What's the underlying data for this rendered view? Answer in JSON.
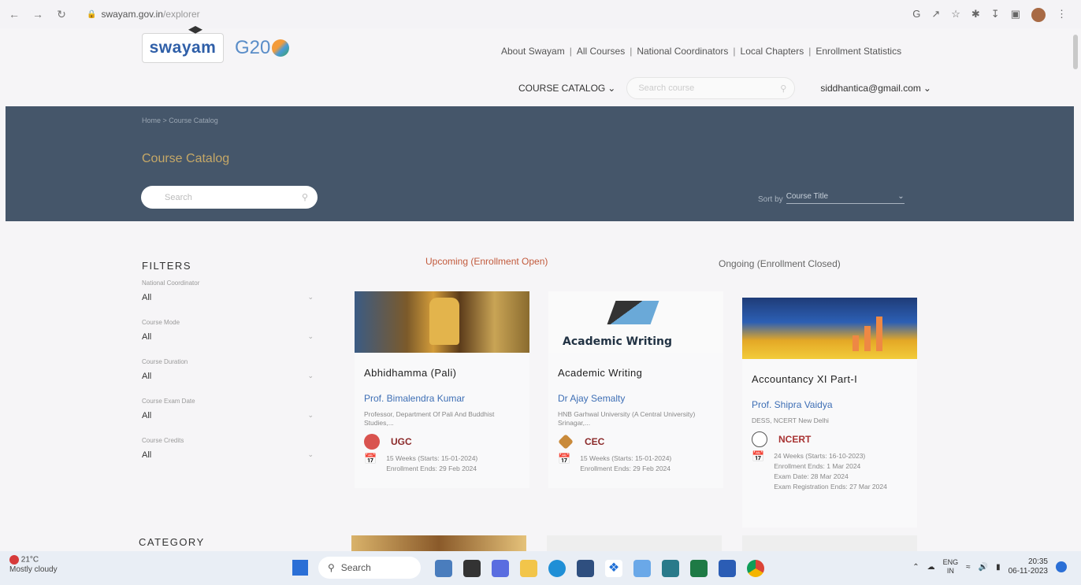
{
  "browser": {
    "url_host": "swayam.gov.in",
    "url_path": "/explorer"
  },
  "header": {
    "logo": "swayam",
    "g20_logo": "G20",
    "links": [
      "About Swayam",
      "All Courses",
      "National Coordinators",
      "Local Chapters",
      "Enrollment Statistics"
    ],
    "link_separator": "|",
    "catalog_label": "COURSE CATALOG",
    "search_placeholder": "Search course",
    "user_email": "siddhantica@gmail.com"
  },
  "banner": {
    "breadcrumb": "Home  >  Course Catalog",
    "title": "Course Catalog",
    "search_placeholder": "Search",
    "sort_prefix": "Sort by",
    "sort_value": "Course Title"
  },
  "filters": {
    "heading": "FILTERS",
    "items": [
      {
        "label": "National Coordinator",
        "value": "All"
      },
      {
        "label": "Course Mode",
        "value": "All"
      },
      {
        "label": "Course Duration",
        "value": "All"
      },
      {
        "label": "Course Exam Date",
        "value": "All"
      },
      {
        "label": "Course Credits",
        "value": "All"
      }
    ],
    "category_heading": "CATEGORY"
  },
  "tabs": {
    "upcoming": "Upcoming (Enrollment Open)",
    "ongoing": "Ongoing (Enrollment Closed)"
  },
  "courses": [
    {
      "title": "Abhidhamma (Pali)",
      "instructor": "Prof. Bimalendra Kumar",
      "org": "Professor, Department Of Pali And Buddhist Studies,...",
      "coordinator": "UGC",
      "duration": "15 Weeks (Starts: 15-01-2024)",
      "extra": [
        "Enrollment Ends: 29 Feb 2024"
      ]
    },
    {
      "title": "Academic Writing",
      "instructor": "Dr Ajay Semalty",
      "org": "HNB Garhwal University (A Central University) Srinagar,...",
      "coordinator": "CEC",
      "duration": "15 Weeks (Starts: 15-01-2024)",
      "extra": [
        "Enrollment Ends: 29 Feb 2024"
      ],
      "thumb_text": "Academic Writing"
    },
    {
      "title": "Accountancy XI Part-I",
      "instructor": "Prof. Shipra Vaidya",
      "org": "DESS, NCERT New Delhi",
      "coordinator": "NCERT",
      "duration": "24 Weeks (Starts: 16-10-2023)",
      "extra": [
        "Enrollment Ends: 1 Mar 2024",
        "Exam Date: 28 Mar 2024",
        "Exam Registration Ends: 27 Mar 2024"
      ]
    }
  ],
  "taskbar": {
    "temp": "21°C",
    "weather": "Mostly cloudy",
    "search_label": "Search",
    "lang_1": "ENG",
    "lang_2": "IN",
    "time": "20:35",
    "date": "06-11-2023"
  },
  "colors": {
    "banner_bg": "#45566a",
    "link_blue": "#3e6fb5",
    "upcoming_tab": "#c25a3c",
    "coordinator_red": "#8b2a2a"
  }
}
